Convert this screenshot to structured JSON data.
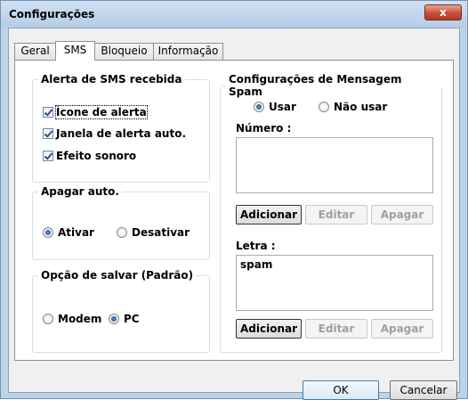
{
  "window": {
    "title": "Configurações",
    "close_label": "x"
  },
  "tabs": [
    "Geral",
    "SMS",
    "Bloqueio",
    "Informação"
  ],
  "alert_group": {
    "legend": "Alerta de SMS recebida",
    "items": [
      {
        "label": "Ícone de alerta",
        "checked": true
      },
      {
        "label": "Janela de alerta auto.",
        "checked": true
      },
      {
        "label": "Efeito sonoro",
        "checked": true
      }
    ]
  },
  "auto_delete": {
    "legend": "Apagar auto.",
    "options": [
      "Ativar",
      "Desativar"
    ],
    "selected": "Ativar"
  },
  "save_option": {
    "legend": "Opção de salvar (Padrão)",
    "options": [
      "Modem",
      "PC"
    ],
    "selected": "PC"
  },
  "spam": {
    "legend": "Configurações de Mensagem Spam",
    "options": [
      "Usar",
      "Não usar"
    ],
    "selected": "Usar",
    "number_label": "Número :",
    "number_items": [],
    "letter_label": "Letra :",
    "letter_items": [
      "spam"
    ],
    "buttons": {
      "add": "Adicionar",
      "edit": "Editar",
      "delete": "Apagar"
    }
  },
  "footer": {
    "ok": "OK",
    "cancel": "Cancelar"
  }
}
